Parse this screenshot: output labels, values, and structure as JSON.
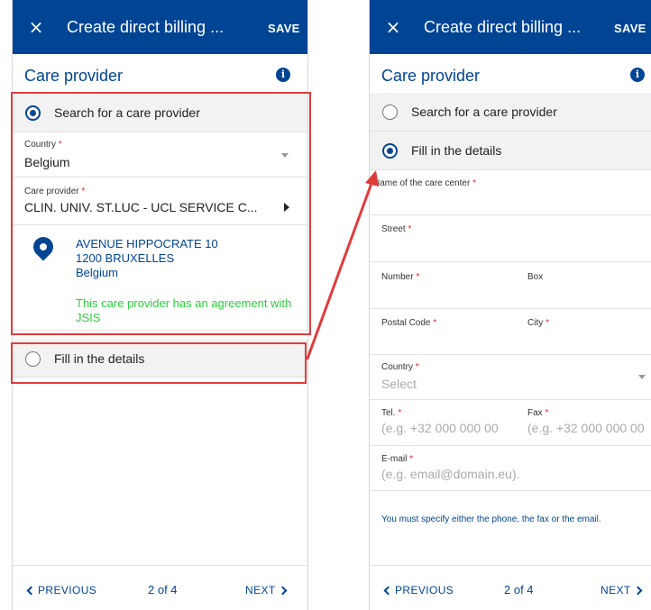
{
  "left": {
    "title": "Create direct billing ...",
    "save": "SAVE",
    "section": "Care provider",
    "radio_search": "Search for a care provider",
    "radio_fill": "Fill in the details",
    "country_label": "Country",
    "country_value": "Belgium",
    "provider_label": "Care provider",
    "provider_value": "CLIN. UNIV. ST.LUC - UCL SERVICE C...",
    "address_line1": "AVENUE HIPPOCRATE 10",
    "address_line2": "1200 BRUXELLES",
    "address_line3": "Belgium",
    "agreement": "This care provider has an agreement with JSIS",
    "footer": {
      "previous": "PREVIOUS",
      "pager": "2 of 4",
      "next": "NEXT"
    }
  },
  "right": {
    "title": "Create direct billing ...",
    "save": "SAVE",
    "section": "Care provider",
    "radio_search": "Search for a care provider",
    "radio_fill": "Fill in the details",
    "fields": {
      "name_label": "Name of the care center",
      "street_label": "Street",
      "number_label": "Number",
      "box_label": "Box",
      "postal_label": "Postal Code",
      "city_label": "City",
      "country_label": "Country",
      "country_placeholder": "Select",
      "tel_label": "Tel.",
      "tel_placeholder": "(e.g. +32 000 000 00",
      "fax_label": "Fax",
      "fax_placeholder": "(e.g. +32 000 000 00",
      "email_label": "E-mail",
      "email_placeholder": "(e.g. email@domain.eu)."
    },
    "note": "You must specify either the phone, the fax or the email.",
    "footer": {
      "previous": "PREVIOUS",
      "pager": "2 of 4",
      "next": "NEXT"
    }
  },
  "required_mark": "*",
  "close_glyph": "×",
  "info_glyph": "i",
  "colors": {
    "brand": "#004494",
    "highlight": "#e03c3c",
    "agreement": "#2ecc40",
    "required": "#d32f2f"
  }
}
